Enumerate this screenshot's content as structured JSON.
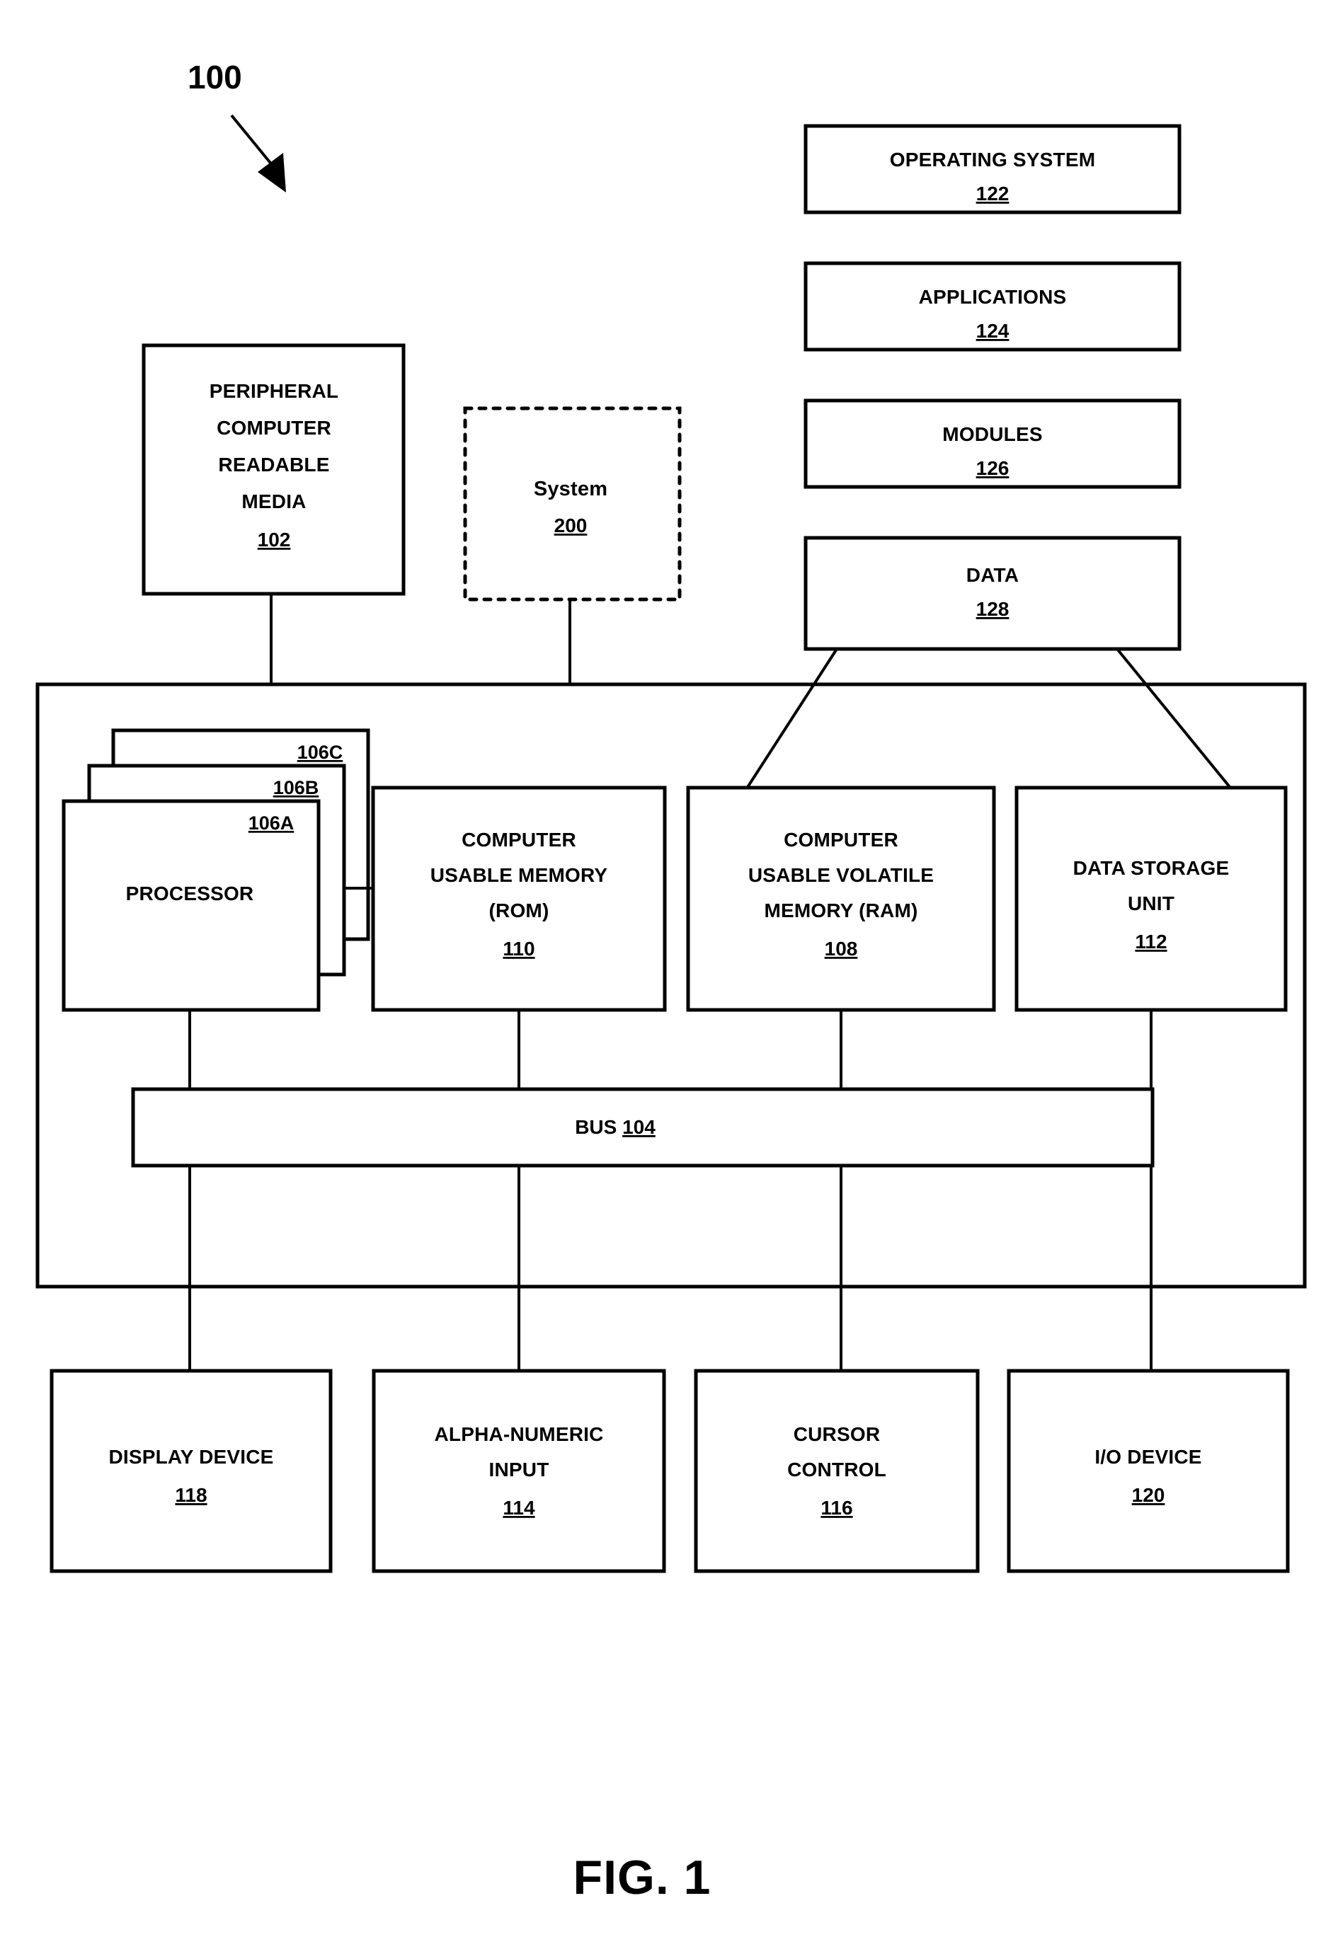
{
  "figure": {
    "tag": "100",
    "caption": "FIG. 1"
  },
  "software_boxes": [
    {
      "label": "OPERATING SYSTEM",
      "ref": "122"
    },
    {
      "label": "APPLICATIONS",
      "ref": "124"
    },
    {
      "label": "MODULES",
      "ref": "126"
    },
    {
      "label": "DATA",
      "ref": "128"
    }
  ],
  "peripheral_media": {
    "line1": "PERIPHERAL",
    "line2": "COMPUTER",
    "line3": "READABLE",
    "line4": "MEDIA",
    "ref": "102"
  },
  "system_box": {
    "label": "System",
    "ref": "200"
  },
  "processor_stack": {
    "label": "PROCESSOR",
    "refs": [
      "106C",
      "106B",
      "106A"
    ]
  },
  "memory_rom": {
    "line1": "COMPUTER",
    "line2": "USABLE MEMORY",
    "line3": "(ROM)",
    "ref": "110"
  },
  "memory_ram": {
    "line1": "COMPUTER",
    "line2": "USABLE VOLATILE",
    "line3": "MEMORY (RAM)",
    "ref": "108"
  },
  "data_storage": {
    "line1": "DATA STORAGE",
    "line2": "UNIT",
    "ref": "112"
  },
  "bus": {
    "label": "BUS",
    "ref": "104"
  },
  "io_boxes": [
    {
      "line1": "DISPLAY DEVICE",
      "line2": "",
      "ref": "118"
    },
    {
      "line1": "ALPHA-NUMERIC",
      "line2": "INPUT",
      "ref": "114"
    },
    {
      "line1": "CURSOR",
      "line2": "CONTROL",
      "ref": "116"
    },
    {
      "line1": "I/O DEVICE",
      "line2": "",
      "ref": "120"
    }
  ],
  "colors": {
    "stroke": "#000000",
    "background": "#ffffff"
  }
}
